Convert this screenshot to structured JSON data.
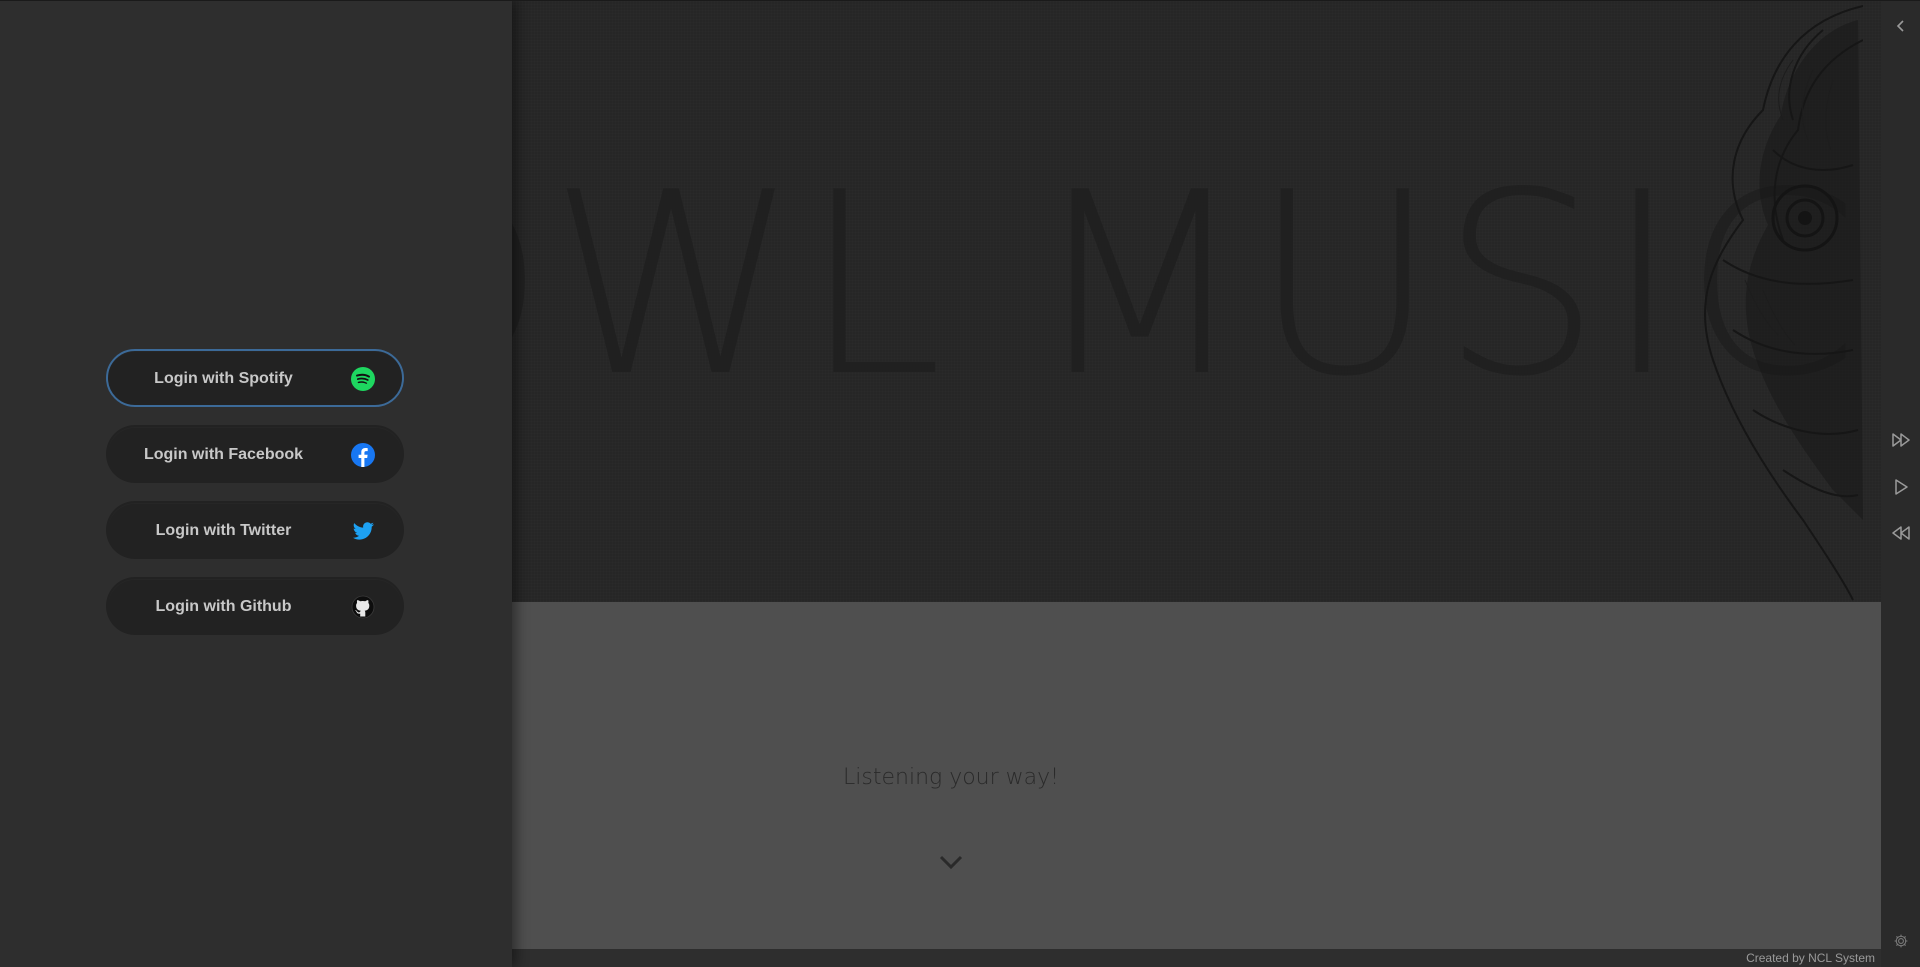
{
  "hero": {
    "title": "OWL MUSIC",
    "tagline": "Listening your way!"
  },
  "login": {
    "buttons": [
      {
        "label": "Login with Spotify",
        "icon": "spotify-icon",
        "color": "#1ed760"
      },
      {
        "label": "Login with Facebook",
        "icon": "facebook-icon",
        "color": "#1877f2"
      },
      {
        "label": "Login with Twitter",
        "icon": "twitter-icon",
        "color": "#1da1f2"
      },
      {
        "label": "Login with Github",
        "icon": "github-icon",
        "color": "#111111"
      }
    ],
    "active_index": 0
  },
  "controls": {
    "collapse": "chevron-left-icon",
    "next": "fast-forward-icon",
    "play": "play-icon",
    "previous": "rewind-icon",
    "settings": "gear-icon"
  },
  "footer": {
    "credit": "Created by NCL System"
  },
  "colors": {
    "drawer_bg": "#2e2e2e",
    "hero_bg": "#262626",
    "lower_bg": "#4f4f4f",
    "active_border": "#3c6a98"
  }
}
